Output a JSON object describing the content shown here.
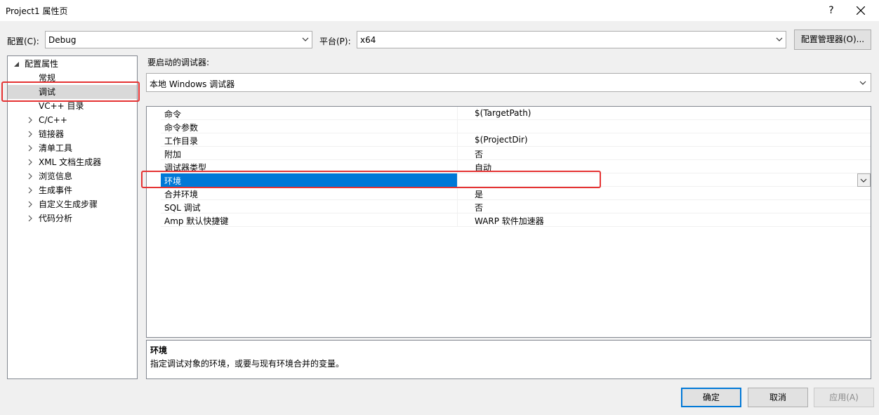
{
  "window": {
    "title": "Project1 属性页",
    "help_label": "?"
  },
  "config_row": {
    "config_label": "配置(C):",
    "config_value": "Debug",
    "platform_label": "平台(P):",
    "platform_value": "x64",
    "manager_button": "配置管理器(O)..."
  },
  "tree": {
    "root": "配置属性",
    "items": [
      {
        "label": "常规",
        "expandable": false
      },
      {
        "label": "调试",
        "expandable": false,
        "selected": true
      },
      {
        "label": "VC++ 目录",
        "expandable": false
      },
      {
        "label": "C/C++",
        "expandable": true
      },
      {
        "label": "链接器",
        "expandable": true
      },
      {
        "label": "清单工具",
        "expandable": true
      },
      {
        "label": "XML 文档生成器",
        "expandable": true
      },
      {
        "label": "浏览信息",
        "expandable": true
      },
      {
        "label": "生成事件",
        "expandable": true
      },
      {
        "label": "自定义生成步骤",
        "expandable": true
      },
      {
        "label": "代码分析",
        "expandable": true
      }
    ]
  },
  "debugger": {
    "label": "要启动的调试器:",
    "selected": "本地 Windows 调试器"
  },
  "properties": [
    {
      "key": "命令",
      "value": "$(TargetPath)"
    },
    {
      "key": "命令参数",
      "value": ""
    },
    {
      "key": "工作目录",
      "value": "$(ProjectDir)"
    },
    {
      "key": "附加",
      "value": "否"
    },
    {
      "key": "调试器类型",
      "value": "自动"
    },
    {
      "key": "环境",
      "value": "",
      "selected": true
    },
    {
      "key": "合并环境",
      "value": "是"
    },
    {
      "key": "SQL 调试",
      "value": "否"
    },
    {
      "key": "Amp 默认快捷键",
      "value": "WARP 软件加速器"
    }
  ],
  "description": {
    "title": "环境",
    "text": "指定调试对象的环境，或要与现有环境合并的变量。"
  },
  "buttons": {
    "ok": "确定",
    "cancel": "取消",
    "apply": "应用(A)"
  },
  "colors": {
    "selection_blue": "#0078d7",
    "annotation_red": "#e53333",
    "tree_selection": "#cde8ff"
  }
}
